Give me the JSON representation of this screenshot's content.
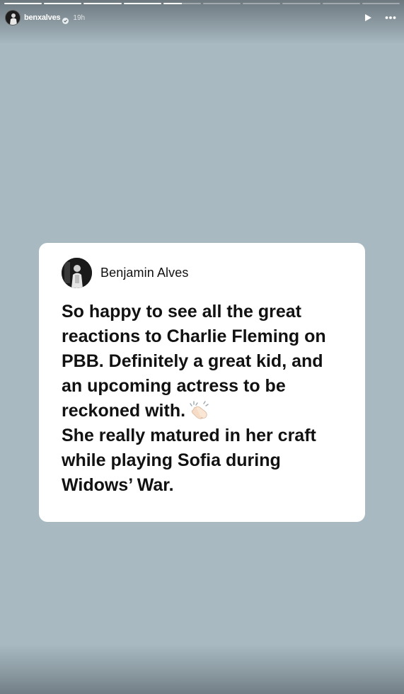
{
  "story": {
    "progress": {
      "segments_total": 10,
      "segments_complete": 4,
      "current_segment_progress": 0.5
    },
    "header": {
      "username": "benxalves",
      "verified_icon": "verified-badge-icon",
      "time_ago": "19h",
      "play_icon": "play-icon",
      "more_icon": "more-options-icon"
    },
    "card": {
      "author_name": "Benjamin Alves",
      "post_paragraph_1": "So happy to see all the great reactions to Charlie Fleming on PBB. Definitely a great kid, and an upcoming actress to be reckoned with.",
      "post_emoji_icon": "clapping-hands-icon",
      "post_paragraph_2": "She really matured in her craft while playing Sofia during Widows’ War."
    },
    "colors": {
      "background": "#a8b9c1",
      "card": "#ffffff",
      "text": "#111111"
    }
  }
}
